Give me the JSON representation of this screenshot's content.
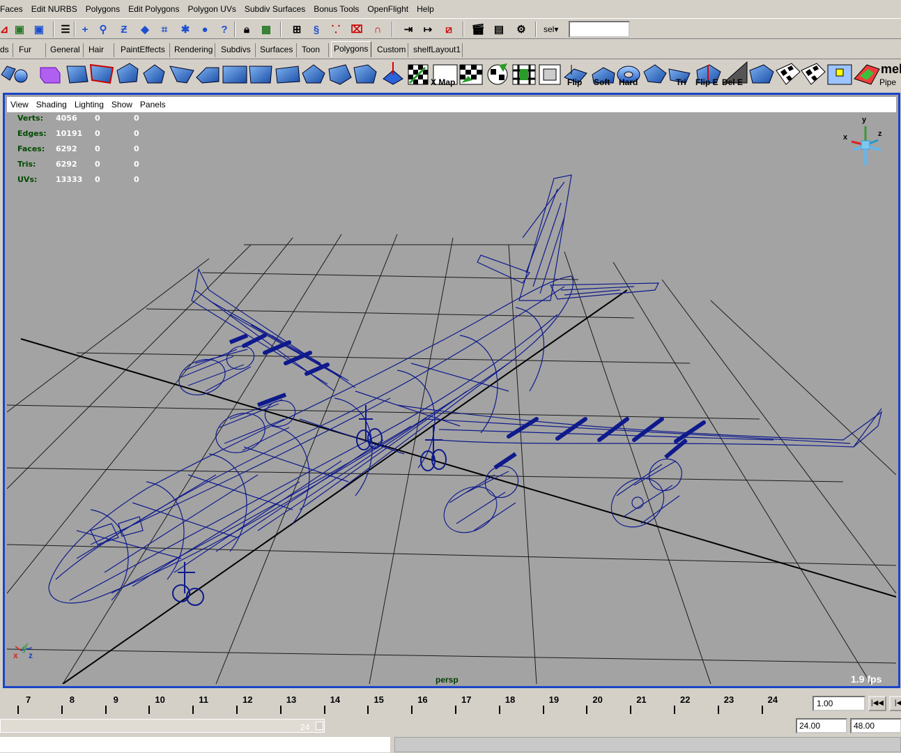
{
  "menubar": [
    "Faces",
    "Edit NURBS",
    "Polygons",
    "Edit Polygons",
    "Polygon UVs",
    "Subdiv Surfaces",
    "Bonus Tools",
    "OpenFlight",
    "Help"
  ],
  "toolline": {
    "sel_label": "sel▾",
    "sel_value": ""
  },
  "shelf_tabs": [
    "ds",
    "Fur",
    "General",
    "Hair",
    "PaintEffects",
    "Rendering",
    "Subdivs",
    "Surfaces",
    "Toon",
    "Polygons",
    "Custom",
    "shelfLayout1"
  ],
  "active_tab": "Polygons",
  "shelf_labels": {
    "xmap": "X Map",
    "flip": "Flip",
    "soft": "Soft",
    "hard": "Hard",
    "tri": "Tri",
    "flip_e": "Flip E",
    "del_e": "Del E",
    "mel": "mel",
    "pipe": "Pipe"
  },
  "panel_menu": [
    "View",
    "Shading",
    "Lighting",
    "Show",
    "Panels"
  ],
  "hud": {
    "rows": [
      {
        "label": "Verts:",
        "v1": "4056",
        "v2": "0",
        "v3": "0"
      },
      {
        "label": "Edges:",
        "v1": "10191",
        "v2": "0",
        "v3": "0"
      },
      {
        "label": "Faces:",
        "v1": "6292",
        "v2": "0",
        "v3": "0"
      },
      {
        "label": "Tris:",
        "v1": "6292",
        "v2": "0",
        "v3": "0"
      },
      {
        "label": "UVs:",
        "v1": "13333",
        "v2": "0",
        "v3": "0"
      }
    ]
  },
  "camera": "persp",
  "fps": "1.9 fps",
  "axis": {
    "x": "x",
    "y": "y",
    "z": "z"
  },
  "timeline": {
    "ticks": [
      "7",
      "8",
      "9",
      "10",
      "11",
      "12",
      "13",
      "14",
      "15",
      "16",
      "17",
      "18",
      "19",
      "20",
      "21",
      "22",
      "23",
      "24"
    ],
    "current_time": "1.00"
  },
  "range": {
    "end_label": "24",
    "playback_end": "24.00",
    "animation_end": "48.00"
  },
  "colors": {
    "viewport_bg": "#a3a3a3",
    "wireframe": "#0e1a8c",
    "viewport_border": "#1b44c8",
    "ui_bg": "#d4d0c8"
  }
}
